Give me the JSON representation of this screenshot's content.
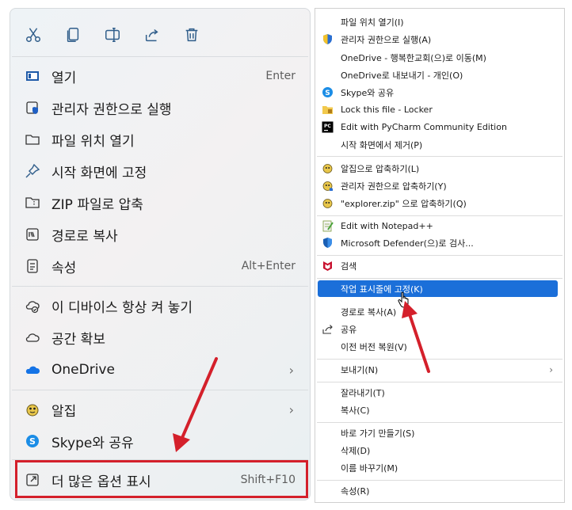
{
  "left_menu": {
    "items": [
      {
        "label": "열기",
        "shortcut": "Enter"
      },
      {
        "label": "관리자 권한으로 실행"
      },
      {
        "label": "파일 위치 열기"
      },
      {
        "label": "시작 화면에 고정"
      },
      {
        "label": "ZIP 파일로 압축"
      },
      {
        "label": "경로로 복사"
      },
      {
        "label": "속성",
        "shortcut": "Alt+Enter"
      },
      {
        "label": "이 디바이스 항상 켜 놓기"
      },
      {
        "label": "공간 확보"
      },
      {
        "label": "OneDrive",
        "chevron": "›"
      },
      {
        "label": "알집",
        "chevron": "›"
      },
      {
        "label": "Skype와 공유"
      },
      {
        "label": "더 많은 옵션 표시",
        "shortcut": "Shift+F10"
      }
    ]
  },
  "right_menu": {
    "items": [
      {
        "label": "파일 위치 열기(I)"
      },
      {
        "label": "관리자 권한으로 실행(A)"
      },
      {
        "label": "OneDrive - 행복한교회(으)로 이동(M)"
      },
      {
        "label": "OneDrive로 내보내기 - 개인(O)"
      },
      {
        "label": "Skype와 공유"
      },
      {
        "label": "Lock this file - Locker"
      },
      {
        "label": "Edit with PyCharm Community Edition"
      },
      {
        "label": "시작 화면에서 제거(P)"
      },
      {
        "label": "알집으로 압축하기(L)"
      },
      {
        "label": "관리자 권한으로 압축하기(Y)"
      },
      {
        "label": "\"explorer.zip\" 으로 압축하기(Q)"
      },
      {
        "label": "Edit with Notepad++"
      },
      {
        "label": "Microsoft Defender(으)로 검사..."
      },
      {
        "label": "검색"
      },
      {
        "label": "작업 표시줄에 고정(K)"
      },
      {
        "label": "경로로 복사(A)"
      },
      {
        "label": "공유"
      },
      {
        "label": "이전 버전 복원(V)"
      },
      {
        "label": "보내기(N)",
        "chevron": "›"
      },
      {
        "label": "잘라내기(T)"
      },
      {
        "label": "복사(C)"
      },
      {
        "label": "바로 가기 만들기(S)"
      },
      {
        "label": "삭제(D)"
      },
      {
        "label": "이름 바꾸기(M)"
      },
      {
        "label": "속성(R)"
      }
    ]
  },
  "colors": {
    "highlight": "#1b6fd9",
    "annotation_red": "#d4202b",
    "toolbar_icon": "#2f5d8a"
  }
}
